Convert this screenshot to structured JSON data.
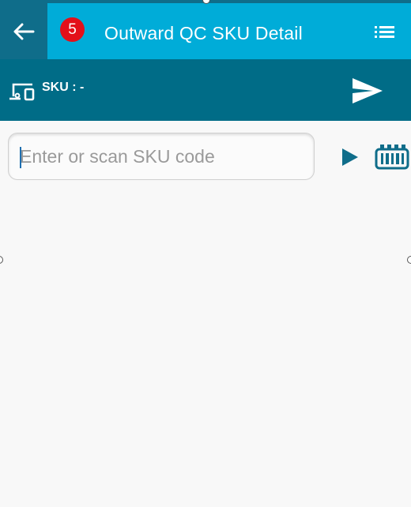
{
  "header": {
    "back_icon": "arrow-left-icon",
    "badge_count": "5",
    "title": "Outward QC SKU Detail",
    "menu_icon": "list-menu-icon",
    "colors": {
      "appbar": "#00acd8",
      "back_area": "#0f6d8a",
      "badge": "#e3101a"
    }
  },
  "info_bar": {
    "device_icon": "devices-icon",
    "sku_label": "SKU : -",
    "send_icon": "send-icon",
    "color": "#006c87"
  },
  "search": {
    "placeholder": "Enter or scan SKU code",
    "value": "",
    "submit_icon": "play-icon",
    "scan_icon": "barcode-scanner-icon"
  }
}
